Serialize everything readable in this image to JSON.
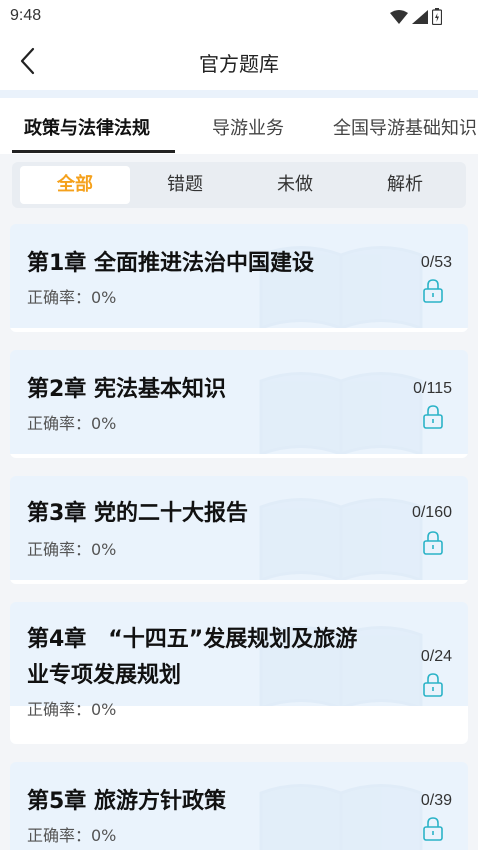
{
  "status_bar": {
    "time": "9:48"
  },
  "header": {
    "title": "官方题库"
  },
  "tabs": [
    {
      "label": "政策与法律法规",
      "active": true
    },
    {
      "label": "导游业务",
      "active": false
    },
    {
      "label": "全国导游基础知识",
      "active": false
    }
  ],
  "filters": [
    {
      "label": "全部",
      "active": true
    },
    {
      "label": "错题",
      "active": false
    },
    {
      "label": "未做",
      "active": false
    },
    {
      "label": "解析",
      "active": false
    }
  ],
  "chapters": [
    {
      "title_line1": "第1章 全面推进法治中国建设",
      "title_line2": "",
      "accuracy": "正确率：0%",
      "count": "0/53",
      "locked": true
    },
    {
      "title_line1": "第2章 宪法基本知识",
      "title_line2": "",
      "accuracy": "正确率：0%",
      "count": "0/115",
      "locked": true
    },
    {
      "title_line1": "第3章 党的二十大报告",
      "title_line2": "",
      "accuracy": "正确率：0%",
      "count": "0/160",
      "locked": true
    },
    {
      "title_line1": "第4章　“十四五”发展规划及旅游",
      "title_line2": "业专项发展规划",
      "accuracy": "正确率：0%",
      "count": "0/24",
      "locked": true
    },
    {
      "title_line1": "第5章 旅游方针政策",
      "title_line2": "",
      "accuracy": "正确率：0%",
      "count": "0/39",
      "locked": true
    }
  ],
  "colors": {
    "accent": "#f5a11c",
    "lock": "#2bb3c7",
    "card_bg": "#eaf3fc"
  },
  "icons": {
    "back": "chevron-left-icon",
    "lock": "lock-icon",
    "wifi": "wifi-icon",
    "signal": "signal-icon",
    "battery": "battery-icon"
  }
}
